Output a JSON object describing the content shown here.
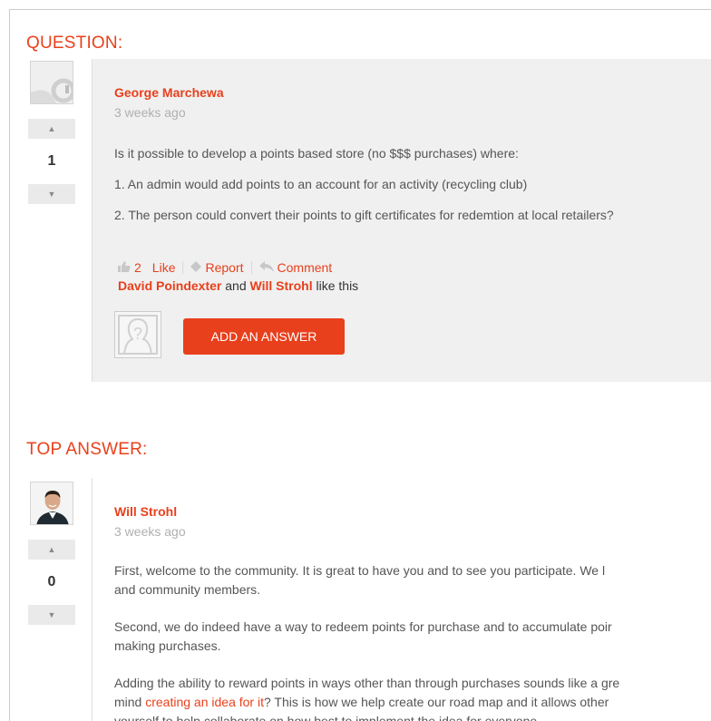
{
  "question": {
    "section_title": "QUESTION:",
    "author": "George Marchewa",
    "time": "3 weeks ago",
    "votes": "1",
    "paragraphs": [
      "Is it possible to develop a points based store (no $$$ purchases) where:",
      "1. An admin would add points to an account for an activity (recycling club)",
      "2. The person could convert their points to gift certificates for redemtion at local retailers?"
    ],
    "like_count": "2",
    "like_label": "Like",
    "report_label": "Report",
    "comment_label": "Comment",
    "likers": [
      "David Poindexter",
      "Will Strohl"
    ],
    "likers_and": "and",
    "likers_suffix": "like this",
    "add_answer_label": "ADD AN ANSWER"
  },
  "answer": {
    "section_title": "TOP ANSWER:",
    "author": "Will Strohl",
    "time": "3 weeks ago",
    "votes": "0",
    "p1_line1": "First, welcome to the community.  It is great to have you and to see you participate.  We l",
    "p1_line2": "and community members.",
    "p2_line1": "Second, we do indeed have a way to redeem points for purchase and to accumulate poir",
    "p2_line2": "making purchases.",
    "p3_line1": "Adding the ability to reward points in ways other than through purchases sounds like a gre",
    "p3_line2_pre": "mind ",
    "p3_link": "creating an idea for it",
    "p3_line2_post": "?  This is how we help create our road map and it allows other",
    "p3_line3": "yourself to help collaborate on how best to implement the idea for everyone."
  },
  "colors": {
    "accent": "#e8401c",
    "panel_bg": "#f0f0f0",
    "muted_text": "#b0b0b0"
  },
  "icons": [
    "thumbs-up-icon",
    "report-icon",
    "reply-icon",
    "vote-up-icon",
    "vote-down-icon",
    "default-avatar-icon",
    "user-photo"
  ]
}
